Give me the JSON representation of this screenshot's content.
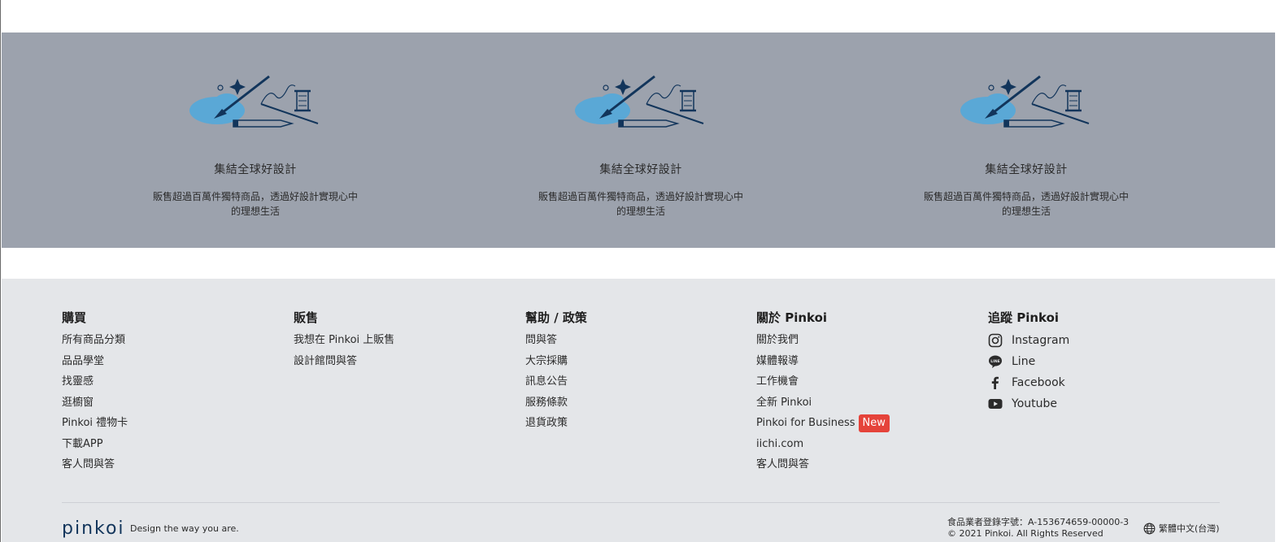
{
  "features": [
    {
      "title": "集結全球好設計",
      "desc": "販售超過百萬件獨特商品，透過好設計實現心中的理想生活"
    },
    {
      "title": "集結全球好設計",
      "desc": "販售超過百萬件獨特商品，透過好設計實現心中的理想生活"
    },
    {
      "title": "集結全球好設計",
      "desc": "販售超過百萬件獨特商品，透過好設計實現心中的理想生活"
    }
  ],
  "footer": {
    "buy": {
      "title": "購買",
      "items": [
        "所有商品分類",
        "品品學堂",
        "找靈感",
        "逛櫥窗",
        "Pinkoi 禮物卡",
        "下載APP",
        "客人問與答"
      ]
    },
    "sell": {
      "title": "販售",
      "items": [
        "我想在 Pinkoi 上販售",
        "設計館問與答"
      ]
    },
    "help": {
      "title": "幫助 / 政策",
      "items": [
        "問與答",
        "大宗採購",
        "訊息公告",
        "服務條款",
        "退貨政策"
      ]
    },
    "about": {
      "title": "關於 Pinkoi",
      "items": [
        "關於我們",
        "媒體報導",
        "工作機會",
        "全新 Pinkoi",
        "Pinkoi for Business",
        "iichi.com",
        "客人問與答"
      ],
      "new_badge": "New"
    },
    "follow": {
      "title": "追蹤 Pinkoi",
      "items": [
        {
          "label": "Instagram",
          "icon": "instagram-icon"
        },
        {
          "label": "Line",
          "icon": "line-icon"
        },
        {
          "label": "Facebook",
          "icon": "facebook-icon"
        },
        {
          "label": "Youtube",
          "icon": "youtube-icon"
        }
      ]
    },
    "logo": "pinkoi",
    "slogan": "Design the way you are.",
    "license": "食品業者登錄字號：A-153674659-00000-3",
    "copyright": "© 2021 Pinkoi. All Rights Reserved",
    "language": "繁體中文(台灣)"
  },
  "colors": {
    "feature_bg": "#9ca2ad",
    "footer_bg": "#e4e6e9",
    "badge_new": "#e5433a",
    "brand": "#12355b"
  }
}
